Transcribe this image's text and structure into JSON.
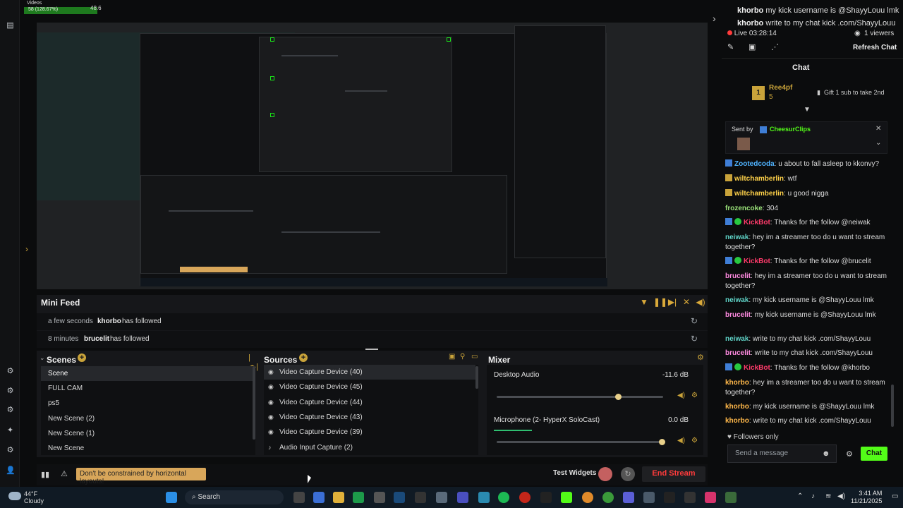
{
  "top_stats": {
    "label": "Videos",
    "value": "58 (128.67%)",
    "peak": "48.6"
  },
  "mini_feed": {
    "title": "Mini Feed",
    "rows": [
      {
        "time": "a few seconds",
        "user": "khorbo",
        "event": "has followed"
      },
      {
        "time": "8 minutes",
        "user": "brucelit",
        "event": "has followed"
      }
    ]
  },
  "scenes": {
    "title": "Scenes",
    "items": [
      "Scene",
      "FULL CAM",
      "ps5",
      "New Scene (2)",
      "New Scene (1)",
      "New Scene"
    ]
  },
  "sources": {
    "title": "Sources",
    "items": [
      "Video Capture Device (40)",
      "Video Capture Device (45)",
      "Video Capture Device (44)",
      "Video Capture Device (43)",
      "Video Capture Device (39)",
      "Audio Input Capture (2)"
    ]
  },
  "mixer": {
    "title": "Mixer",
    "channels": [
      {
        "name": "Desktop Audio",
        "db": "-11.6 dB",
        "level": 0.73
      },
      {
        "name": "Microphone (2- HyperX SoloCast)",
        "db": "0.0 dB",
        "level": 1.0
      }
    ]
  },
  "bottom": {
    "tip": "Don't be constrained by horizontal layouts!",
    "test_widgets": "Test Widgets",
    "end_stream": "End Stream"
  },
  "chat": {
    "top_lines": [
      {
        "user": "khorbo",
        "text": "my kick username is @ShayyLouu lmk"
      },
      {
        "user": "khorbo",
        "text": "write to my chat kick .com/ShayyLouu"
      }
    ],
    "live": "Live 03:28:14",
    "viewers": "1 viewers",
    "refresh": "Refresh Chat",
    "title": "Chat",
    "sub": {
      "rank": "1",
      "name": "Ree4pf",
      "count": "5",
      "gift": "Gift 1 sub to take 2nd"
    },
    "sent_by_label": "Sent by",
    "sent_by_user": "CheesurClips",
    "messages": [
      {
        "user": "Zootedcoda",
        "text": "u about to fall asleep to kkonvy?",
        "color": "#4fb3ff",
        "badge": "k"
      },
      {
        "user": "wiltchamberlin",
        "text": "wtf",
        "color": "#ffd24a",
        "badge": "c"
      },
      {
        "user": "wiltchamberlin",
        "text": "u good nigga",
        "color": "#ffd24a",
        "badge": "c"
      },
      {
        "user": "frozencoke",
        "text": "304",
        "color": "#9be37a",
        "badge": ""
      },
      {
        "user": "KickBot",
        "text": "Thanks for the follow @neiwak",
        "color": "#ff3b6b",
        "badge": "kg"
      },
      {
        "user": "neiwak",
        "text": "hey im a streamer too do u want to stream together?",
        "color": "#5fd3c7",
        "badge": ""
      },
      {
        "user": "KickBot",
        "text": "Thanks for the follow @brucelit",
        "color": "#ff3b6b",
        "badge": "kg"
      },
      {
        "user": "brucelit",
        "text": "hey im a streamer too do u want to stream together?",
        "color": "#ff8ae0",
        "badge": ""
      },
      {
        "user": "neiwak",
        "text": "my kick username is @ShayyLouu lmk",
        "color": "#5fd3c7",
        "badge": ""
      },
      {
        "user": "brucelit",
        "text": "my kick username is @ShayyLouu lmk",
        "color": "#ff8ae0",
        "badge": ""
      },
      {
        "user": "neiwak",
        "text": "write to my chat kick .com/ShayyLouu",
        "color": "#5fd3c7",
        "badge": ""
      },
      {
        "user": "brucelit",
        "text": "write to my chat kick .com/ShayyLouu",
        "color": "#ff8ae0",
        "badge": ""
      },
      {
        "user": "KickBot",
        "text": "Thanks for the follow @khorbo",
        "color": "#ff3b6b",
        "badge": "kg"
      },
      {
        "user": "khorbo",
        "text": "hey im a streamer too do u want to stream together?",
        "color": "#ffb84a",
        "badge": ""
      },
      {
        "user": "khorbo",
        "text": "my kick username is @ShayyLouu lmk",
        "color": "#ffb84a",
        "badge": ""
      },
      {
        "user": "khorbo",
        "text": "write to my chat kick .com/ShayyLouu",
        "color": "#ffb84a",
        "badge": ""
      }
    ],
    "followers_only": "Followers only",
    "send_placeholder": "Send a message",
    "chat_button": "Chat"
  },
  "taskbar": {
    "temp": "44°F",
    "condition": "Cloudy",
    "search": "Search",
    "time": "3:41 AM",
    "date": "11/21/2025"
  },
  "colors": {
    "accent": "#53fc18",
    "end_stream": "#ff3b3b",
    "tip_bg": "#d8a65a"
  }
}
